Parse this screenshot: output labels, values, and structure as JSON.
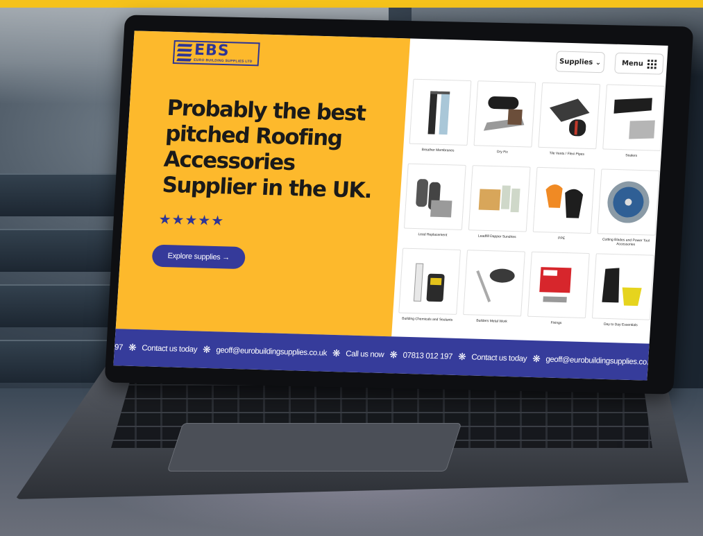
{
  "logo": {
    "letters": "EBS",
    "subtitle": "EURO BUILDING SUPPLIES LTD"
  },
  "hero": {
    "headline": "Probably the best pitched Roofing Accessories Supplier in the UK.",
    "stars": "★★★★★",
    "cta_label": "Explore supplies →"
  },
  "nav": {
    "supplies_label": "Supplies ⌄",
    "menu_label": "Menu"
  },
  "products": [
    {
      "label": "Breather Membranes"
    },
    {
      "label": "Dry Fix"
    },
    {
      "label": "Tile Vents / Flexi Pipes"
    },
    {
      "label": "Sealers"
    },
    {
      "label": "Lead Replacement"
    },
    {
      "label": "Leadfill Dapper Sundries"
    },
    {
      "label": "PPE"
    },
    {
      "label": "Cutting Blades and Power Tool Accessories"
    },
    {
      "label": "Building Chemicals and Sealants"
    },
    {
      "label": "Builders Metal Work"
    },
    {
      "label": "Fixings"
    },
    {
      "label": "Day to Day Essentials"
    }
  ],
  "ticker": [
    "97",
    "Contact us today",
    "geoff@eurobuildingsupplies.co.uk",
    "Call us now",
    "07813 012 197",
    "Contact us today",
    "geoff@eurobuildingsupplies.co.uk"
  ],
  "colors": {
    "brand_yellow": "#fdb92c",
    "brand_blue": "#363c9b"
  }
}
